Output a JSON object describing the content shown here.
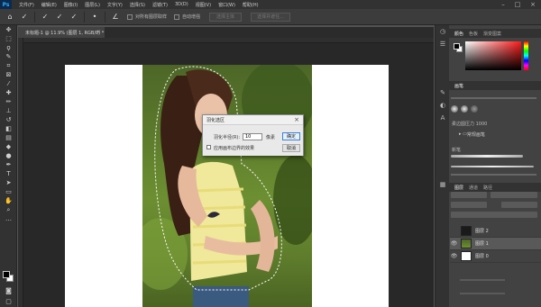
{
  "app": {
    "logo": "Ps"
  },
  "menu": [
    "文件(F)",
    "编辑(E)",
    "图像(I)",
    "图层(L)",
    "文字(Y)",
    "选择(S)",
    "滤镜(T)",
    "3D(D)",
    "视图(V)",
    "窗口(W)",
    "帮助(H)"
  ],
  "options": {
    "check1_label": "对所有图层取样",
    "check2_label": "自动增强",
    "btn1": "选择主体",
    "btn2": "选择并遮住..."
  },
  "document": {
    "tab_title": "未标题-1 @ 11.9% (图层 1, RGB/8) *"
  },
  "dialog": {
    "title": "羽化选区",
    "radius_label": "羽化半径(R):",
    "radius_value": "10",
    "unit": "像素",
    "ok": "确定",
    "cancel": "取消",
    "checkbox_label": "应用画布边界的效果"
  },
  "right_panels": {
    "color_tabs": [
      "颜色",
      "色板",
      "渐变图案"
    ],
    "brush_tabs": [
      "画笔"
    ],
    "brush_label": "柔边圆压力 1000",
    "folder1": "常规画笔",
    "folder2": "新笔",
    "layer_tabs": [
      "图层",
      "通道",
      "路径"
    ],
    "layers": [
      {
        "name": "图层 2"
      },
      {
        "name": "图层 1"
      },
      {
        "name": "图层 0"
      }
    ]
  }
}
